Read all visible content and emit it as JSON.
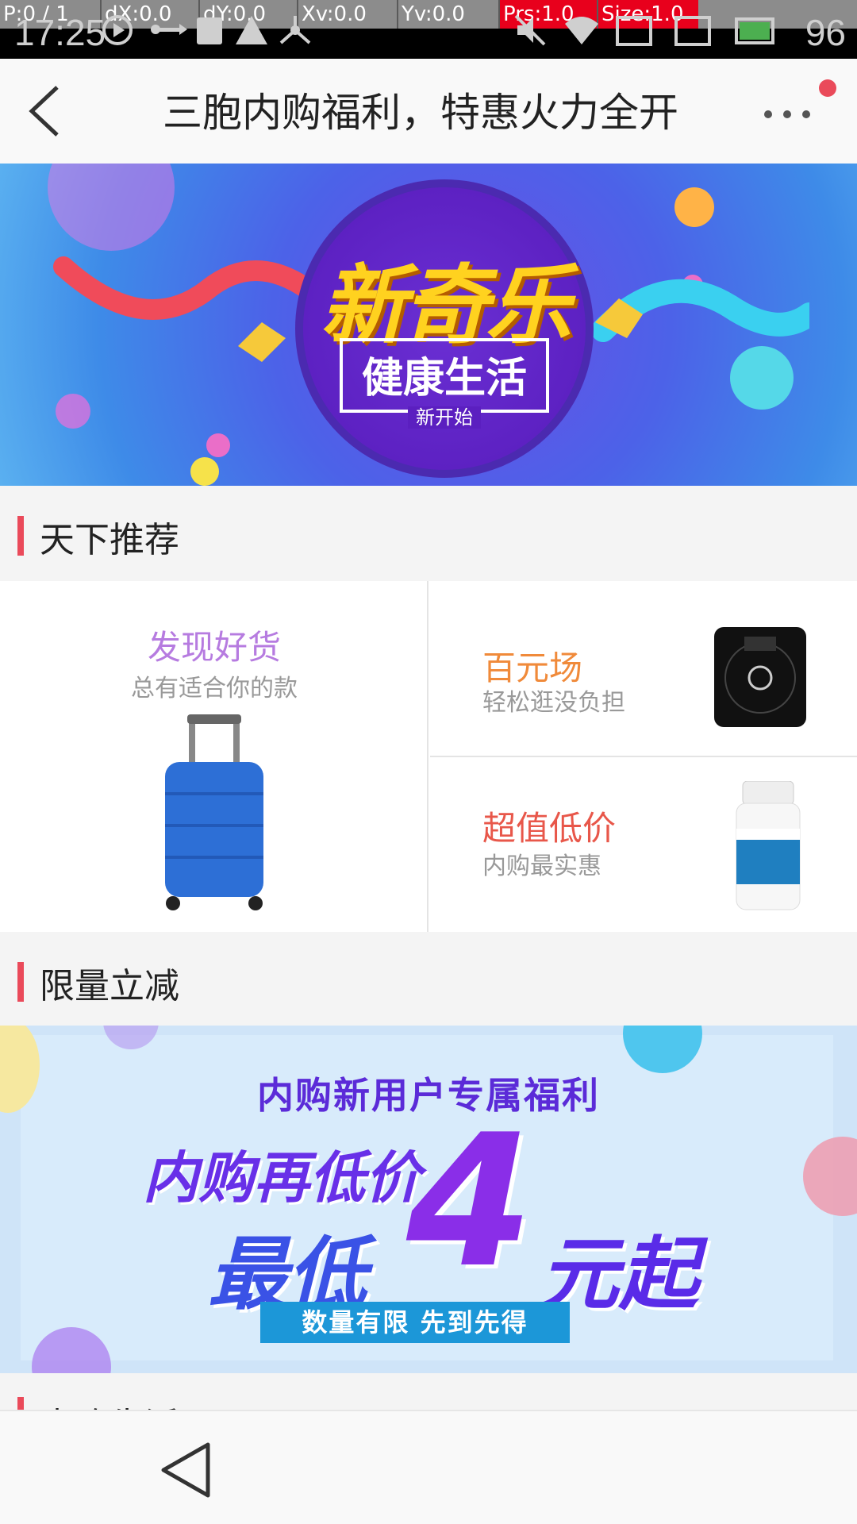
{
  "status_bar": {
    "time": "17:25",
    "battery": "96",
    "debug": {
      "p": "P:0 / 1",
      "dx": "dX:0.0",
      "dy": "dY:0.0",
      "xv": "Xv:0.0",
      "yv": "Yv:0.0",
      "prs": "Prs:1.0",
      "size": "Size:1.0"
    }
  },
  "header": {
    "title": "三胞内购福利，特惠火力全开"
  },
  "banner1": {
    "title": "新奇乐",
    "subtitle": "健康生活",
    "tagline": "新开始"
  },
  "sections": {
    "recommend": "天下推荐",
    "limited": "限量立减",
    "third": "内购生活"
  },
  "recommend_grid": {
    "left": {
      "title": "发现好货",
      "subtitle": "总有适合你的款"
    },
    "right_top": {
      "title": "百元场",
      "subtitle": "轻松逛没负担"
    },
    "right_bottom": {
      "title": "超值低价",
      "subtitle": "内购最实惠"
    }
  },
  "banner2": {
    "headline": "内购新用户专属福利",
    "line1": "内购再低价",
    "line2": "最低",
    "number": "4",
    "tail": "元起",
    "strip": "数量有限 先到先得"
  },
  "colors": {
    "accent": "#ea4a5a",
    "left_title": "#b67be0",
    "right_title": "#f08a3a"
  }
}
